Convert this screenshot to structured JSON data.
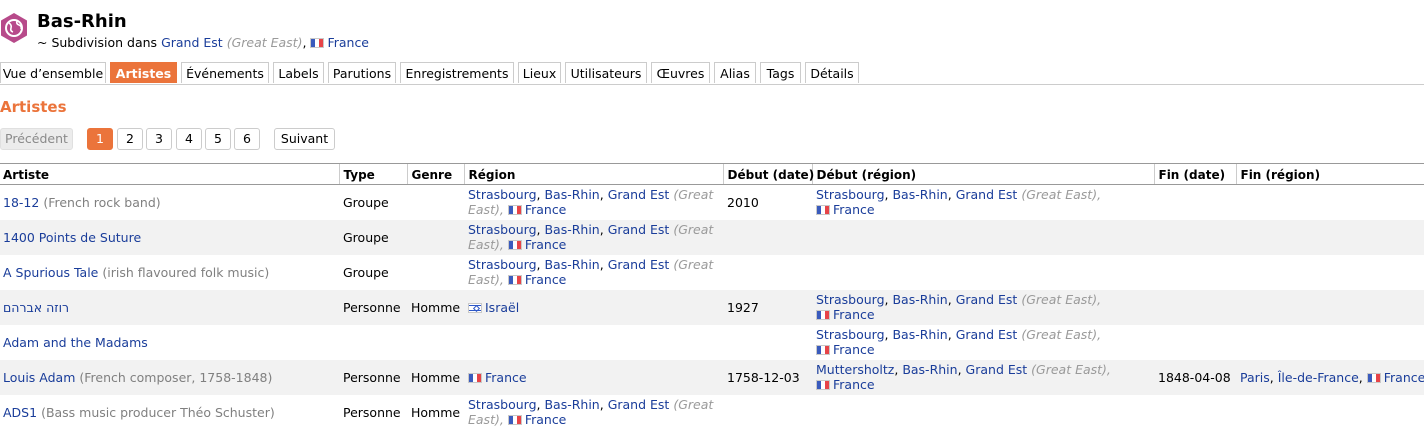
{
  "header": {
    "title": "Bas-Rhin",
    "sub_prefix": "~ Subdivision dans",
    "parent": "Grand Est",
    "parent_alias": "(Great East)",
    "country": "France"
  },
  "tabs": [
    "Vue d’ensemble",
    "Artistes",
    "Événements",
    "Labels",
    "Parutions",
    "Enregistrements",
    "Lieux",
    "Utilisateurs",
    "Œuvres",
    "Alias",
    "Tags",
    "Détails"
  ],
  "active_tab": "Artistes",
  "section_title": "Artistes",
  "pagination": {
    "prev": "Précédent",
    "pages": [
      "1",
      "2",
      "3",
      "4",
      "5",
      "6"
    ],
    "current": "1",
    "next": "Suivant"
  },
  "columns": [
    "Artiste",
    "Type",
    "Genre",
    "Région",
    "Début (date)",
    "Début (région)",
    "Fin (date)",
    "Fin (région)"
  ],
  "rows": [
    {
      "name": "18-12",
      "comment": "(French rock band)",
      "type": "Groupe",
      "genre": "",
      "region_l1": [
        "Strasbourg",
        "Bas-Rhin",
        "Grand Est",
        "(Great"
      ],
      "region_l2": [
        "East),",
        "France"
      ],
      "begin_date": "2010",
      "begin_l1": [
        "Strasbourg",
        "Bas-Rhin",
        "Grand Est",
        "(Great East),"
      ],
      "begin_l2": "France",
      "end_date": "",
      "end_region": ""
    },
    {
      "name": "1400 Points de Suture",
      "comment": "",
      "type": "Groupe",
      "genre": "",
      "region_l1": [
        "Strasbourg",
        "Bas-Rhin",
        "Grand Est",
        "(Great"
      ],
      "region_l2": [
        "East),",
        "France"
      ],
      "begin_date": "",
      "begin_l1": [],
      "begin_l2": "",
      "end_date": "",
      "end_region": ""
    },
    {
      "name": "A Spurious Tale",
      "comment": "(irish flavoured folk music)",
      "type": "Groupe",
      "genre": "",
      "region_l1": [
        "Strasbourg",
        "Bas-Rhin",
        "Grand Est",
        "(Great"
      ],
      "region_l2": [
        "East),",
        "France"
      ],
      "begin_date": "",
      "begin_l1": [],
      "begin_l2": "",
      "end_date": "",
      "end_region": ""
    },
    {
      "name": "רוזה אברהם",
      "comment": "",
      "type": "Personne",
      "genre": "Homme",
      "region_country": "Israël",
      "region_flag": "il",
      "begin_date": "1927",
      "begin_l1": [
        "Strasbourg",
        "Bas-Rhin",
        "Grand Est",
        "(Great East),"
      ],
      "begin_l2": "France",
      "end_date": "",
      "end_region": ""
    },
    {
      "name": "Adam and the Madams",
      "comment": "",
      "type": "",
      "genre": "",
      "region_l1": [],
      "region_l2": [],
      "begin_date": "",
      "begin_l1": [
        "Strasbourg",
        "Bas-Rhin",
        "Grand Est",
        "(Great East),"
      ],
      "begin_l2": "France",
      "end_date": "",
      "end_region": ""
    },
    {
      "name": "Louis Adam",
      "comment": "(French composer, 1758-1848)",
      "type": "Personne",
      "genre": "Homme",
      "region_country": "France",
      "region_flag": "fr",
      "begin_date": "1758-12-03",
      "begin_l1": [
        "Muttersholtz",
        "Bas-Rhin",
        "Grand Est",
        "(Great East),"
      ],
      "begin_l2": "France",
      "end_date": "1848-04-08",
      "end_region": [
        "Paris",
        "Île-de-France",
        "France"
      ]
    },
    {
      "name": "ADS1",
      "comment": "(Bass music producer Théo Schuster)",
      "type": "Personne",
      "genre": "Homme",
      "region_l1": [
        "Strasbourg",
        "Bas-Rhin",
        "Grand Est",
        "(Great"
      ],
      "region_l2": [
        "East),",
        "France"
      ],
      "begin_date": "",
      "begin_l1": [],
      "begin_l2": "",
      "end_date": "",
      "end_region": ""
    }
  ],
  "colors": {
    "accent": "#eb743b",
    "link": "#1a3d9a",
    "muted": "#808080",
    "stripe": "#f2f2f2"
  },
  "icons": {
    "area": "globe-icon",
    "flag_fr": "flag-france-icon",
    "flag_il": "flag-israel-icon"
  }
}
